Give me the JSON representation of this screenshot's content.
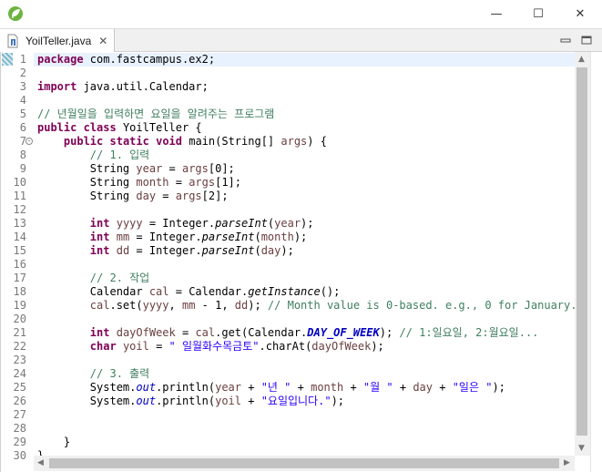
{
  "window": {
    "minimize_glyph": "—",
    "maximize_glyph": "☐",
    "close_glyph": "✕"
  },
  "tab": {
    "label": "YoilTeller.java",
    "close_glyph": "✕"
  },
  "code_lines": [
    [
      {
        "t": "package",
        "c": "kw"
      },
      {
        "t": " com.fastcampus.ex2;"
      }
    ],
    [],
    [
      {
        "t": "import",
        "c": "kw"
      },
      {
        "t": " java.util.Calendar;"
      }
    ],
    [],
    [
      {
        "t": "// 년월일을 입력하면 요일을 알려주는 프로그램",
        "c": "cm"
      }
    ],
    [
      {
        "t": "public",
        "c": "kw"
      },
      {
        "t": " "
      },
      {
        "t": "class",
        "c": "kw"
      },
      {
        "t": " YoilTeller {"
      }
    ],
    [
      {
        "t": "    "
      },
      {
        "t": "public",
        "c": "kw"
      },
      {
        "t": " "
      },
      {
        "t": "static",
        "c": "kw"
      },
      {
        "t": " "
      },
      {
        "t": "void",
        "c": "kw"
      },
      {
        "t": " main(String[] "
      },
      {
        "t": "args",
        "c": "var"
      },
      {
        "t": ") {"
      }
    ],
    [
      {
        "t": "        "
      },
      {
        "t": "// 1. 입력",
        "c": "cm"
      }
    ],
    [
      {
        "t": "        String "
      },
      {
        "t": "year",
        "c": "var"
      },
      {
        "t": " = "
      },
      {
        "t": "args",
        "c": "var"
      },
      {
        "t": "[0];"
      }
    ],
    [
      {
        "t": "        String "
      },
      {
        "t": "month",
        "c": "var"
      },
      {
        "t": " = "
      },
      {
        "t": "args",
        "c": "var"
      },
      {
        "t": "[1];"
      }
    ],
    [
      {
        "t": "        String "
      },
      {
        "t": "day",
        "c": "var"
      },
      {
        "t": " = "
      },
      {
        "t": "args",
        "c": "var"
      },
      {
        "t": "[2];"
      }
    ],
    [],
    [
      {
        "t": "        "
      },
      {
        "t": "int",
        "c": "kw"
      },
      {
        "t": " "
      },
      {
        "t": "yyyy",
        "c": "var"
      },
      {
        "t": " = Integer."
      },
      {
        "t": "parseInt",
        "c": "it"
      },
      {
        "t": "("
      },
      {
        "t": "year",
        "c": "var"
      },
      {
        "t": ");"
      }
    ],
    [
      {
        "t": "        "
      },
      {
        "t": "int",
        "c": "kw"
      },
      {
        "t": " "
      },
      {
        "t": "mm",
        "c": "var"
      },
      {
        "t": " = Integer."
      },
      {
        "t": "parseInt",
        "c": "it"
      },
      {
        "t": "("
      },
      {
        "t": "month",
        "c": "var"
      },
      {
        "t": ");"
      }
    ],
    [
      {
        "t": "        "
      },
      {
        "t": "int",
        "c": "kw"
      },
      {
        "t": " "
      },
      {
        "t": "dd",
        "c": "var"
      },
      {
        "t": " = Integer."
      },
      {
        "t": "parseInt",
        "c": "it"
      },
      {
        "t": "("
      },
      {
        "t": "day",
        "c": "var"
      },
      {
        "t": ");"
      }
    ],
    [],
    [
      {
        "t": "        "
      },
      {
        "t": "// 2. 작업",
        "c": "cm"
      }
    ],
    [
      {
        "t": "        Calendar "
      },
      {
        "t": "cal",
        "c": "var"
      },
      {
        "t": " = Calendar."
      },
      {
        "t": "getInstance",
        "c": "it"
      },
      {
        "t": "();"
      }
    ],
    [
      {
        "t": "        "
      },
      {
        "t": "cal",
        "c": "var"
      },
      {
        "t": ".set("
      },
      {
        "t": "yyyy",
        "c": "var"
      },
      {
        "t": ", "
      },
      {
        "t": "mm",
        "c": "var"
      },
      {
        "t": " - 1, "
      },
      {
        "t": "dd",
        "c": "var"
      },
      {
        "t": "); "
      },
      {
        "t": "// Month value is 0-based. e.g., 0 for January.",
        "c": "cm"
      }
    ],
    [],
    [
      {
        "t": "        "
      },
      {
        "t": "int",
        "c": "kw"
      },
      {
        "t": " "
      },
      {
        "t": "dayOfWeek",
        "c": "var"
      },
      {
        "t": " = "
      },
      {
        "t": "cal",
        "c": "var"
      },
      {
        "t": ".get(Calendar."
      },
      {
        "t": "DAY_OF_WEEK",
        "c": "fld"
      },
      {
        "t": "); "
      },
      {
        "t": "// 1:일요일, 2:월요일...",
        "c": "cm"
      }
    ],
    [
      {
        "t": "        "
      },
      {
        "t": "char",
        "c": "kw"
      },
      {
        "t": " "
      },
      {
        "t": "yoil",
        "c": "var"
      },
      {
        "t": " = "
      },
      {
        "t": "\" 일월화수목금토\"",
        "c": "st"
      },
      {
        "t": ".charAt("
      },
      {
        "t": "dayOfWeek",
        "c": "var"
      },
      {
        "t": ");"
      }
    ],
    [],
    [
      {
        "t": "        "
      },
      {
        "t": "// 3. 출력",
        "c": "cm"
      }
    ],
    [
      {
        "t": "        System."
      },
      {
        "t": "out",
        "c": "fldi"
      },
      {
        "t": ".println("
      },
      {
        "t": "year",
        "c": "var"
      },
      {
        "t": " + "
      },
      {
        "t": "\"년 \"",
        "c": "st"
      },
      {
        "t": " + "
      },
      {
        "t": "month",
        "c": "var"
      },
      {
        "t": " + "
      },
      {
        "t": "\"월 \"",
        "c": "st"
      },
      {
        "t": " + "
      },
      {
        "t": "day",
        "c": "var"
      },
      {
        "t": " + "
      },
      {
        "t": "\"일은 \"",
        "c": "st"
      },
      {
        "t": ");"
      }
    ],
    [
      {
        "t": "        System."
      },
      {
        "t": "out",
        "c": "fldi"
      },
      {
        "t": ".println("
      },
      {
        "t": "yoil",
        "c": "var"
      },
      {
        "t": " + "
      },
      {
        "t": "\"요일입니다.\"",
        "c": "st"
      },
      {
        "t": ");"
      }
    ],
    [],
    [],
    [
      {
        "t": "    }"
      }
    ],
    [
      {
        "t": "}"
      }
    ]
  ],
  "fold_marker_line": 7,
  "colors": {
    "keyword": "#7f0055",
    "comment": "#3f7f5f",
    "string": "#2a00ff",
    "static_field": "#0000c0",
    "local_variable": "#6a3e3e",
    "current_line": "#e8f2fe"
  }
}
